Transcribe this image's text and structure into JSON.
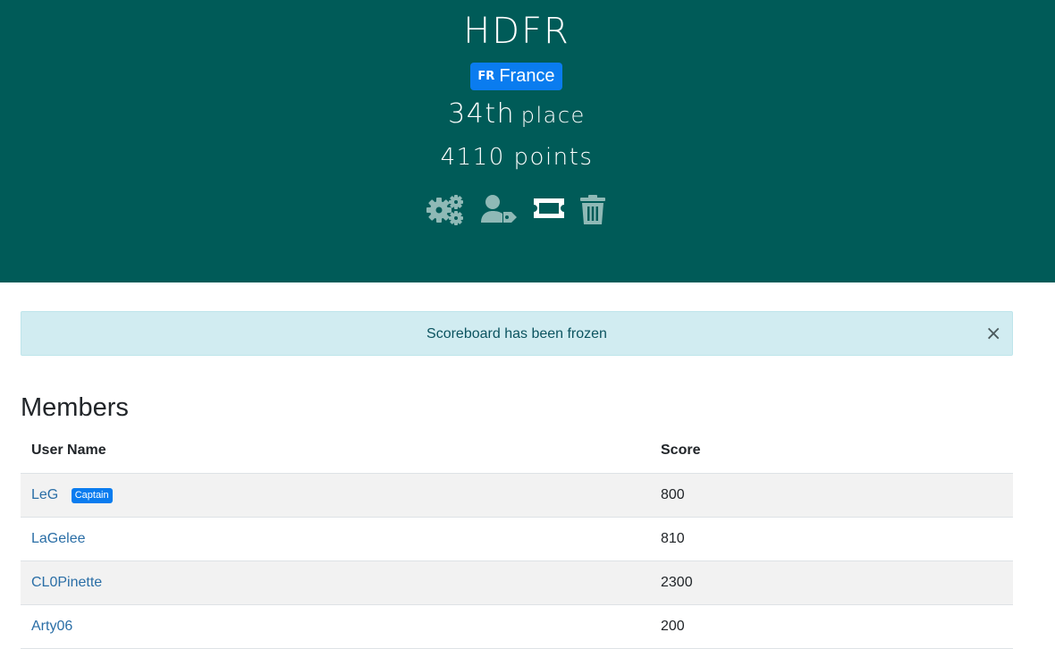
{
  "team": {
    "name": "HDFR",
    "country_code": "FR",
    "country_name": "France",
    "place_number": "34",
    "place_suffix": "th",
    "place_word": "place",
    "points": "4110 points"
  },
  "actions": [
    {
      "name": "team-settings",
      "icon": "cogs-icon"
    },
    {
      "name": "transfer-captain",
      "icon": "user-tag-icon"
    },
    {
      "name": "team-ticket",
      "icon": "ticket-icon"
    },
    {
      "name": "delete-team",
      "icon": "trash-icon"
    }
  ],
  "alert": {
    "message": "Scoreboard has been frozen",
    "close_symbol": "×"
  },
  "members": {
    "heading": "Members",
    "columns": [
      "User Name",
      "Score"
    ],
    "rows": [
      {
        "user": "LeG",
        "badge": "Captain",
        "score": "800"
      },
      {
        "user": "LaGelee",
        "badge": "",
        "score": "810"
      },
      {
        "user": "CL0Pinette",
        "badge": "",
        "score": "2300"
      },
      {
        "user": "Arty06",
        "badge": "",
        "score": "200"
      }
    ]
  },
  "colors": {
    "header_bg": "#005b58",
    "badge_blue": "#0a7cef",
    "icon_muted": "#8fb9b6",
    "link": "#2a6ea6",
    "alert_bg": "#d1ecf1",
    "alert_text": "#0c5460"
  }
}
